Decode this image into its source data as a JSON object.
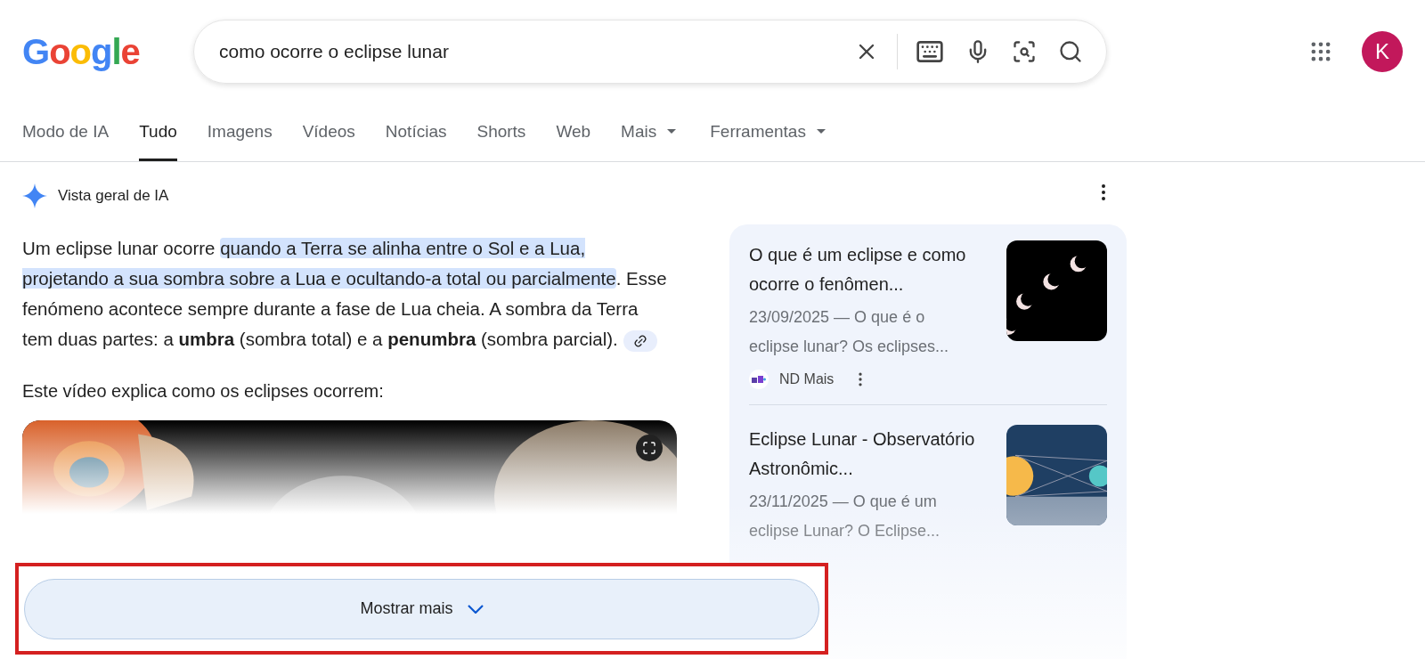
{
  "logo": "Google",
  "search": {
    "value": "como ocorre o eclipse lunar"
  },
  "account": {
    "initial": "K"
  },
  "tabs": [
    {
      "label": "Modo de IA",
      "selected": false,
      "dropdown": false
    },
    {
      "label": "Tudo",
      "selected": true,
      "dropdown": false
    },
    {
      "label": "Imagens",
      "selected": false,
      "dropdown": false
    },
    {
      "label": "Vídeos",
      "selected": false,
      "dropdown": false
    },
    {
      "label": "Notícias",
      "selected": false,
      "dropdown": false
    },
    {
      "label": "Shorts",
      "selected": false,
      "dropdown": false
    },
    {
      "label": "Web",
      "selected": false,
      "dropdown": false
    },
    {
      "label": "Mais",
      "selected": false,
      "dropdown": true
    },
    {
      "label": "Ferramentas",
      "selected": false,
      "dropdown": true
    }
  ],
  "overview": {
    "title": "Vista geral de IA",
    "paragraph": [
      {
        "text": "Um eclipse lunar ocorre ",
        "highlighted": false
      },
      {
        "text": "quando a Terra se alinha entre o Sol e a Lua, projetando a sua sombra sobre a Lua e ocultando-a total ou parcialmente",
        "highlighted": true
      },
      {
        "text": ". Esse fenómeno acontece sempre durante a fase de Lua cheia. A sombra da Terra tem duas partes: a **umbra** (sombra total) e a **penumbra** (sombra parcial).",
        "highlighted": false
      }
    ],
    "video_intro": "Este vídeo explica como os eclipses ocorrem:",
    "show_more": "Mostrar mais",
    "sources": [
      {
        "title": "O que é um eclipse e como ocorre o fenômen...",
        "snippet": "23/09/2025 — O que é o eclipse lunar? Os eclipses...",
        "site": "ND Mais",
        "kind": "moons"
      },
      {
        "title": "Eclipse Lunar - Observatório Astronômic...",
        "snippet": "23/11/2025 — O que é um eclipse Lunar? O Eclipse...",
        "kind": "diagram"
      }
    ]
  }
}
